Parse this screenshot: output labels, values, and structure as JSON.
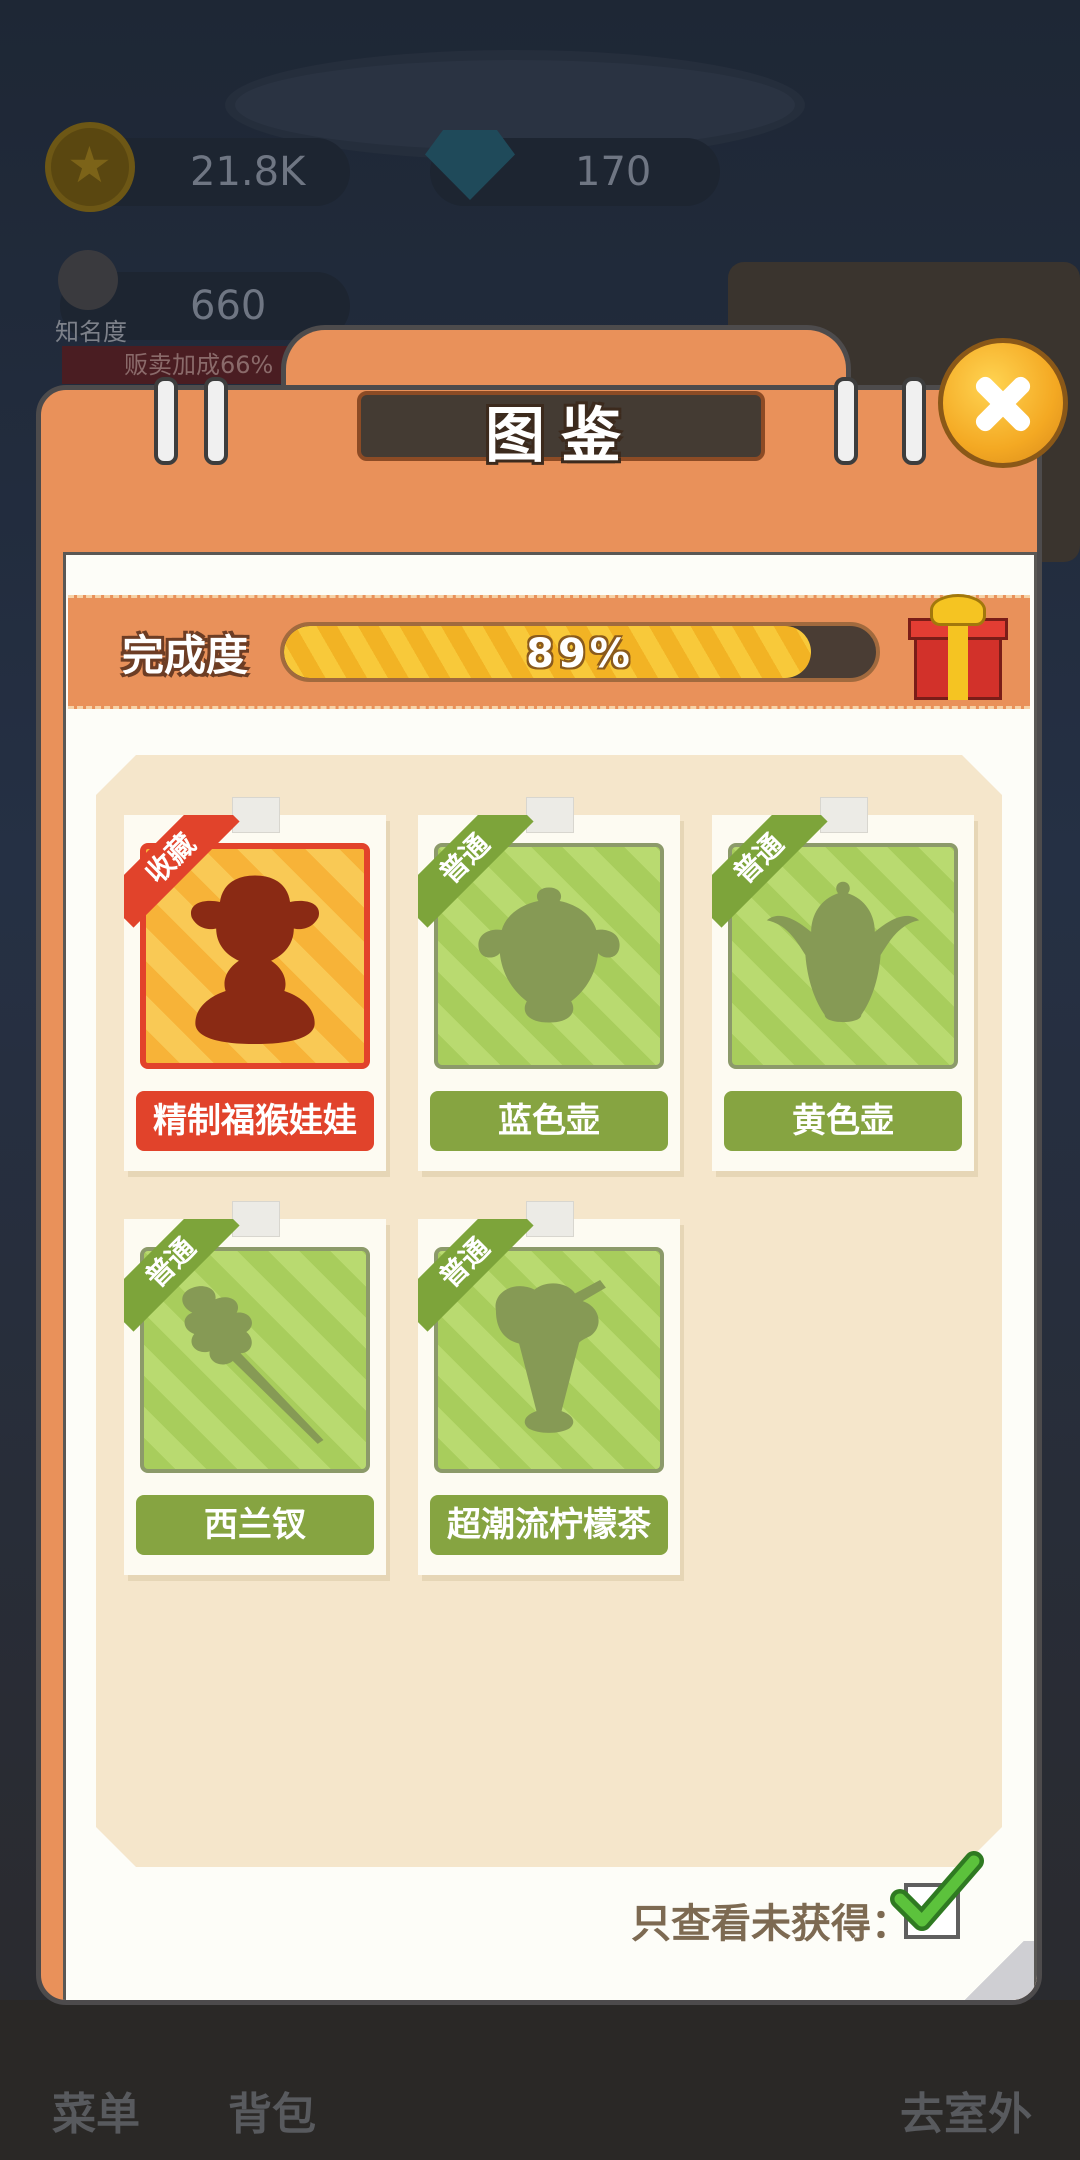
{
  "hud": {
    "coins": "21.8K",
    "gems": "170",
    "fame_value": "660",
    "fame_label": "知名度",
    "sales_bonus": "贩卖加成66%"
  },
  "bottom_nav": {
    "menu": "菜单",
    "bag": "背包",
    "outdoor": "去室外"
  },
  "modal": {
    "title": "图鉴",
    "completion_label": "完成度",
    "completion_text": "89%",
    "completion_fraction": 0.89,
    "items": [
      {
        "name": "精制福猴娃娃",
        "rarity": "收藏",
        "style": "collectible"
      },
      {
        "name": "蓝色壶",
        "rarity": "普通",
        "style": "common"
      },
      {
        "name": "黄色壶",
        "rarity": "普通",
        "style": "common"
      },
      {
        "name": "西兰钗",
        "rarity": "普通",
        "style": "common"
      },
      {
        "name": "超潮流柠檬茶",
        "rarity": "普通",
        "style": "common"
      }
    ],
    "filter_label": "只查看未获得：",
    "filter_checked": true
  },
  "colors": {
    "modal_orange": "#e9915a",
    "common_green": "#86a441",
    "collectible_red": "#e1432b",
    "progress_yellow": "#f8c93a"
  }
}
